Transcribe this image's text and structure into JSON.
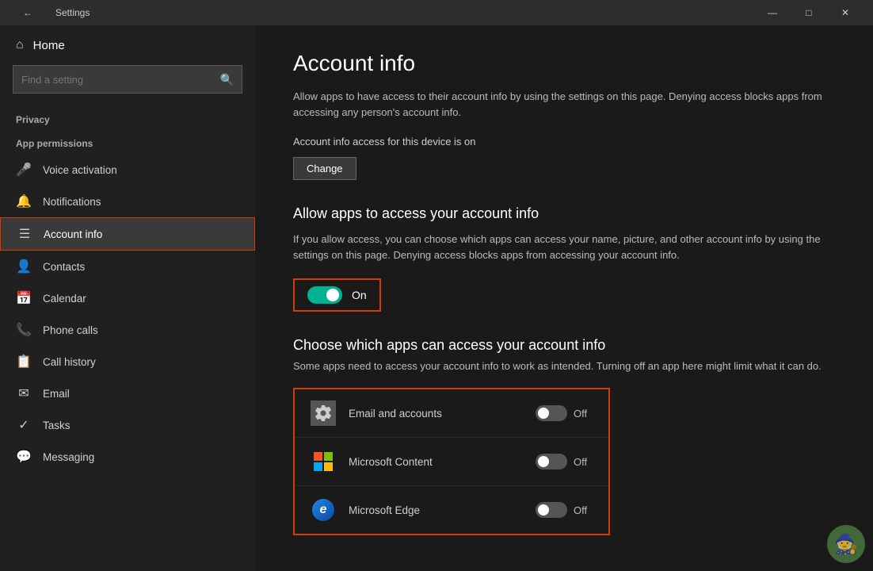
{
  "titlebar": {
    "back_icon": "←",
    "title": "Settings",
    "minimize": "—",
    "maximize": "□",
    "close": "✕"
  },
  "sidebar": {
    "home_label": "Home",
    "search_placeholder": "Find a setting",
    "privacy_label": "Privacy",
    "app_permissions_label": "App permissions",
    "items": [
      {
        "id": "voice-activation",
        "label": "Voice activation",
        "icon": "🎤"
      },
      {
        "id": "notifications",
        "label": "Notifications",
        "icon": "🔔"
      },
      {
        "id": "account-info",
        "label": "Account info",
        "icon": "☰",
        "active": true
      },
      {
        "id": "contacts",
        "label": "Contacts",
        "icon": "👤"
      },
      {
        "id": "calendar",
        "label": "Calendar",
        "icon": "📅"
      },
      {
        "id": "phone-calls",
        "label": "Phone calls",
        "icon": "📞"
      },
      {
        "id": "call-history",
        "label": "Call history",
        "icon": "📋"
      },
      {
        "id": "email",
        "label": "Email",
        "icon": "✉"
      },
      {
        "id": "tasks",
        "label": "Tasks",
        "icon": "✓"
      },
      {
        "id": "messaging",
        "label": "Messaging",
        "icon": "💬"
      }
    ]
  },
  "main": {
    "page_title": "Account info",
    "intro_text": "Allow apps to have access to their account info by using the settings on this page. Denying access blocks apps from accessing any person's account info.",
    "device_access_label": "Account info access for this device is on",
    "change_btn_label": "Change",
    "allow_section_heading": "Allow apps to access your account info",
    "allow_section_desc": "If you allow access, you can choose which apps can access your name, picture, and other account info by using the settings on this page. Denying access blocks apps from accessing your account info.",
    "main_toggle_state": "On",
    "choose_section_heading": "Choose which apps can access your account info",
    "choose_section_desc": "Some apps need to access your account info to work as intended. Turning off an app here might limit what it can do.",
    "apps": [
      {
        "id": "email-accounts",
        "name": "Email and accounts",
        "icon_type": "gear",
        "toggle": "Off"
      },
      {
        "id": "ms-content",
        "name": "Microsoft Content",
        "icon_type": "ms-logo",
        "toggle": "Off"
      },
      {
        "id": "ms-edge",
        "name": "Microsoft Edge",
        "icon_type": "edge",
        "toggle": "Off"
      }
    ]
  }
}
